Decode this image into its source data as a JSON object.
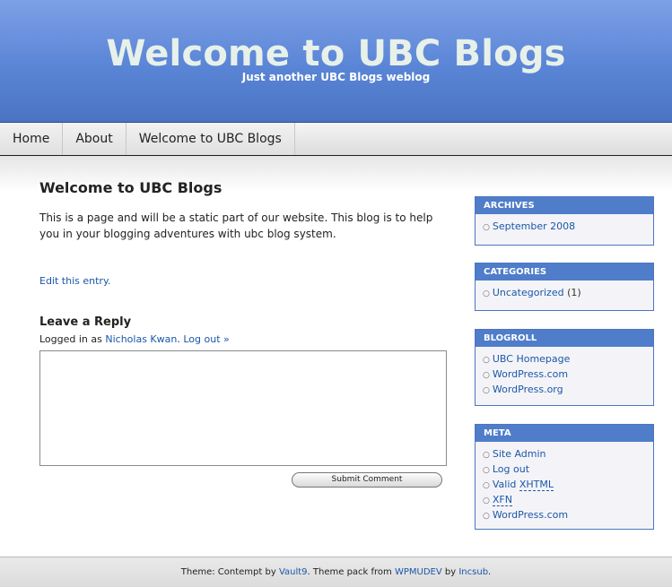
{
  "header": {
    "title": "Welcome to UBC Blogs",
    "description": "Just another UBC Blogs weblog"
  },
  "nav": {
    "items": [
      {
        "label": "Home"
      },
      {
        "label": "About"
      },
      {
        "label": "Welcome to UBC Blogs"
      }
    ]
  },
  "post": {
    "title": "Welcome to UBC Blogs",
    "body": "This is a page and will be a static part of our website.  This blog is to help you in your blogging adventures with ubc blog system.",
    "edit_link": "Edit this entry."
  },
  "reply": {
    "heading": "Leave a Reply",
    "logged_in_prefix": "Logged in as",
    "user_name": "Nicholas Kwan",
    "logout_link": "Log out »",
    "comment_value": "",
    "submit_label": "Submit Comment"
  },
  "sidebar": {
    "archives": {
      "title": "ARCHIVES",
      "items": [
        {
          "label": "September 2008"
        }
      ]
    },
    "categories": {
      "title": "CATEGORIES",
      "items": [
        {
          "label": "Uncategorized",
          "count": "(1)"
        }
      ]
    },
    "blogroll": {
      "title": "BLOGROLL",
      "items": [
        {
          "label": "UBC Homepage"
        },
        {
          "label": "WordPress.com"
        },
        {
          "label": "WordPress.org"
        }
      ]
    },
    "meta": {
      "title": "META",
      "items": [
        {
          "label": "Site Admin"
        },
        {
          "label": "Log out"
        },
        {
          "prefix": "Valid",
          "label": "XHTML"
        },
        {
          "label": "XFN"
        },
        {
          "label": "WordPress.com"
        }
      ]
    }
  },
  "footer": {
    "theme_prefix": "Theme: Contempt by",
    "theme_author": "Vault9",
    "pack_prefix": ". Theme pack from",
    "pack_source": "WPMUDEV",
    "by_text": "by",
    "pack_author": "Incsub",
    "end": "."
  },
  "colors": {
    "header_gradient_top": "#7ea0e6",
    "header_gradient_bottom": "#4a74c2",
    "title_text": "#e7f1e9",
    "link": "#1a57a8",
    "widget_header": "#4f7dc9"
  }
}
